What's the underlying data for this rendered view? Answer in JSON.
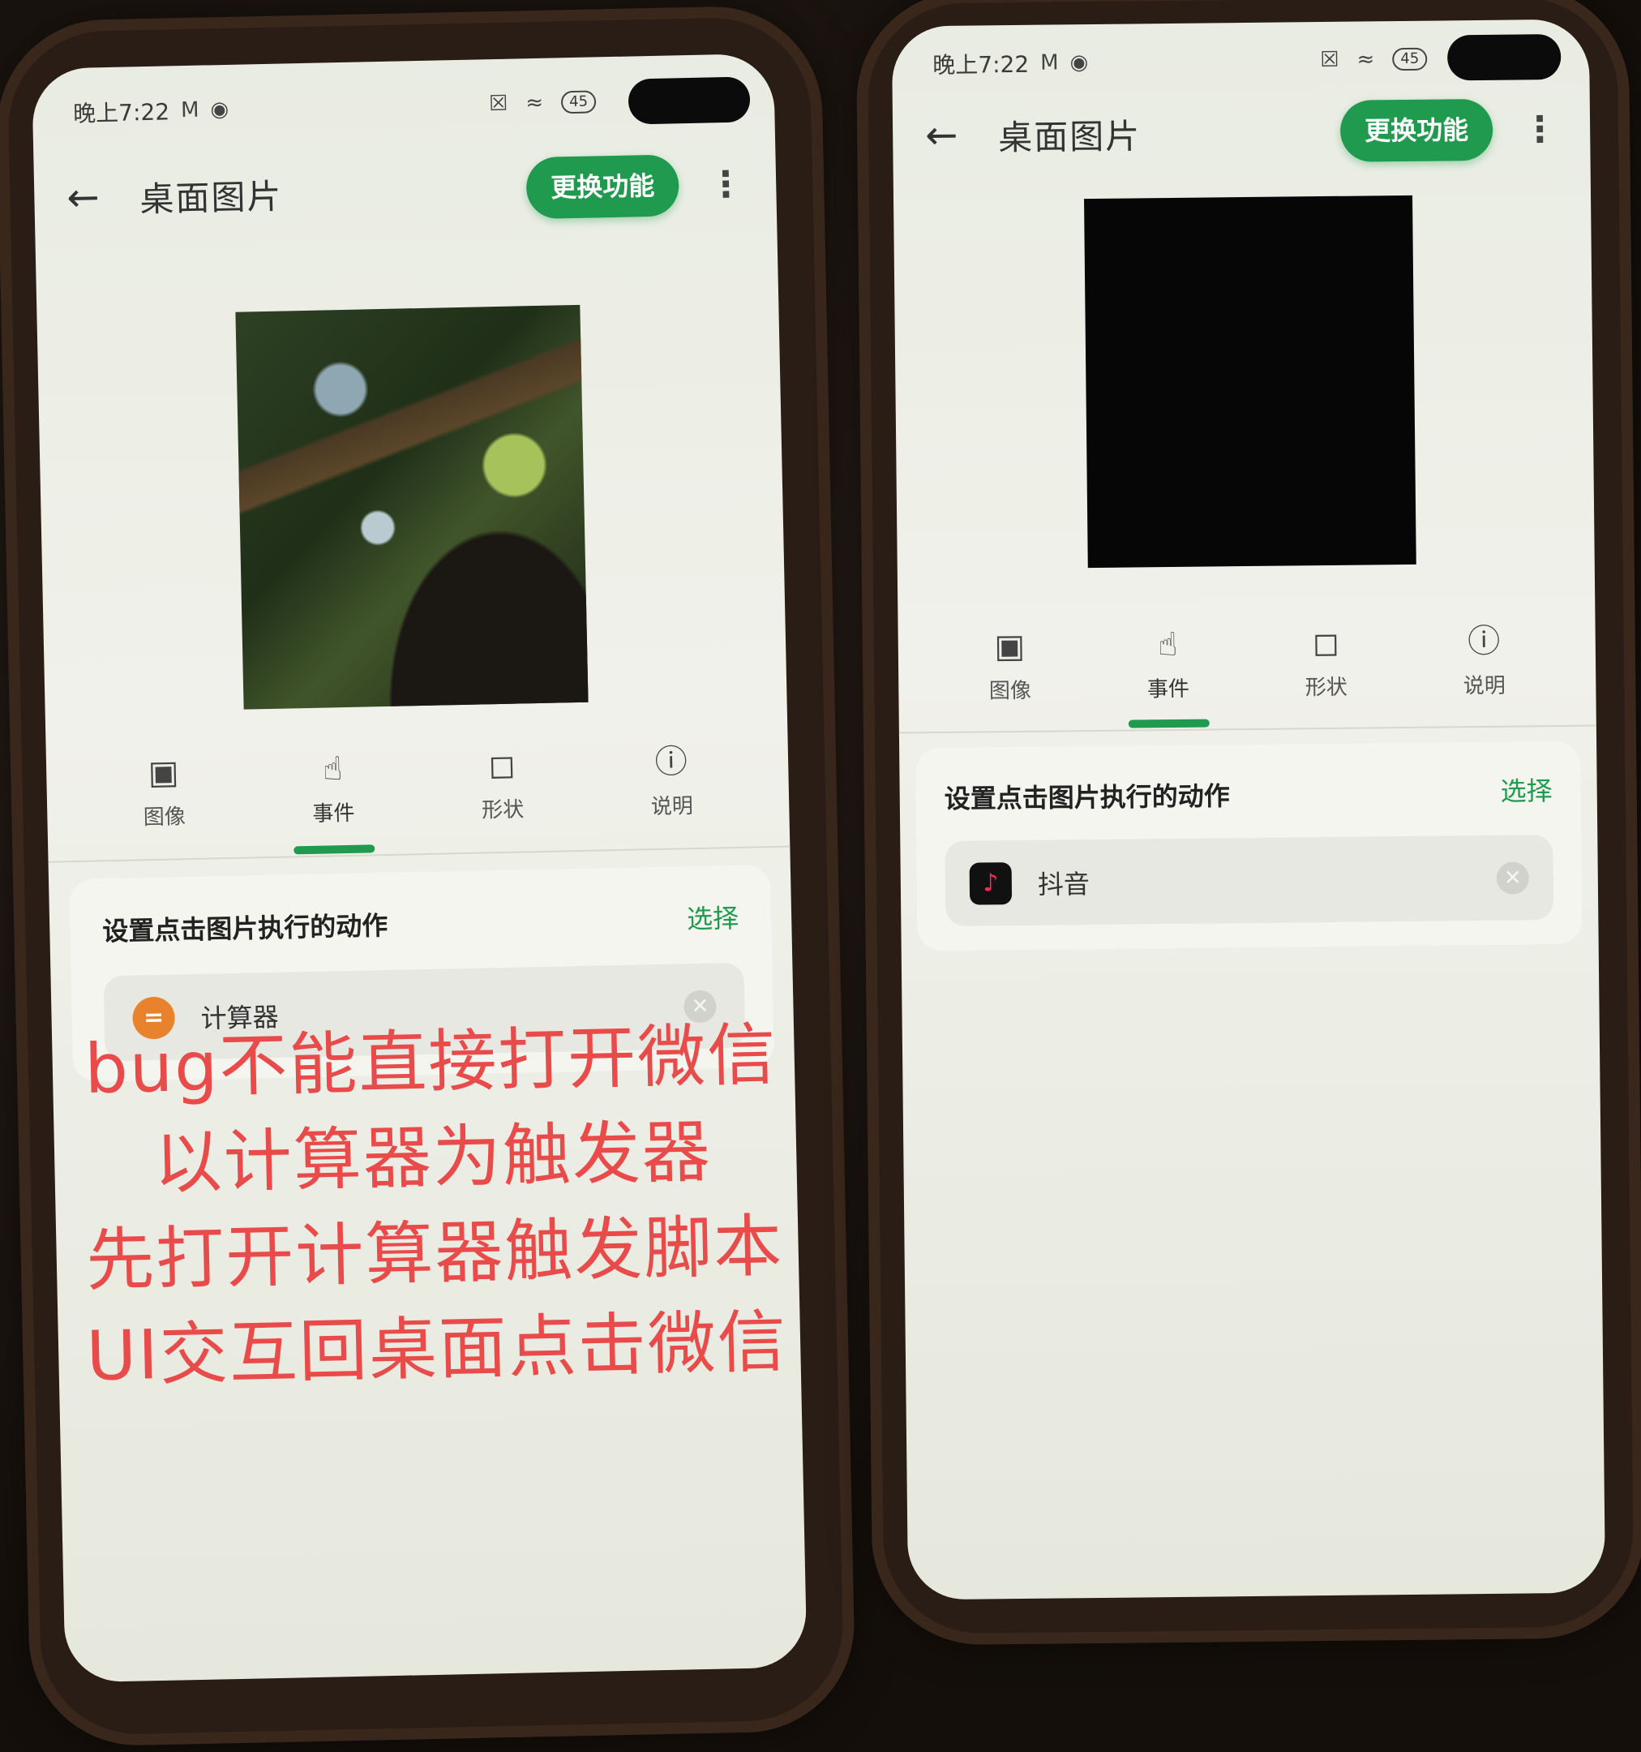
{
  "phones": [
    {
      "status": {
        "time": "晚上7:22",
        "signal_icon": "M",
        "battery": "45"
      },
      "app_bar": {
        "title": "桌面图片",
        "switch_label": "更换功能"
      },
      "tabs": [
        {
          "icon": "image-icon",
          "label": "图像"
        },
        {
          "icon": "touch-icon",
          "label": "事件",
          "active": true
        },
        {
          "icon": "shape-icon",
          "label": "形状"
        },
        {
          "icon": "info-icon",
          "label": "说明"
        }
      ],
      "card": {
        "title": "设置点击图片执行的动作",
        "select_label": "选择",
        "action": {
          "name": "计算器",
          "icon": "calculator-icon",
          "icon_glyph": "="
        }
      }
    },
    {
      "status": {
        "time": "晚上7:22",
        "signal_icon": "M",
        "battery": "45"
      },
      "app_bar": {
        "title": "桌面图片",
        "switch_label": "更换功能"
      },
      "tabs": [
        {
          "icon": "image-icon",
          "label": "图像"
        },
        {
          "icon": "touch-icon",
          "label": "事件",
          "active": true
        },
        {
          "icon": "shape-icon",
          "label": "形状"
        },
        {
          "icon": "info-icon",
          "label": "说明"
        }
      ],
      "card": {
        "title": "设置点击图片执行的动作",
        "select_label": "选择",
        "action": {
          "name": "抖音",
          "icon": "douyin-icon",
          "icon_glyph": "♪"
        }
      }
    }
  ],
  "annotation": {
    "lines": [
      "bug不能直接打开微信",
      "以计算器为触发器",
      "先打开计算器触发脚本",
      "UI交互回桌面点击微信"
    ]
  },
  "colors": {
    "accent": "#1f9a4e",
    "annotation": "#e94a4a",
    "calculator": "#e9822d"
  }
}
